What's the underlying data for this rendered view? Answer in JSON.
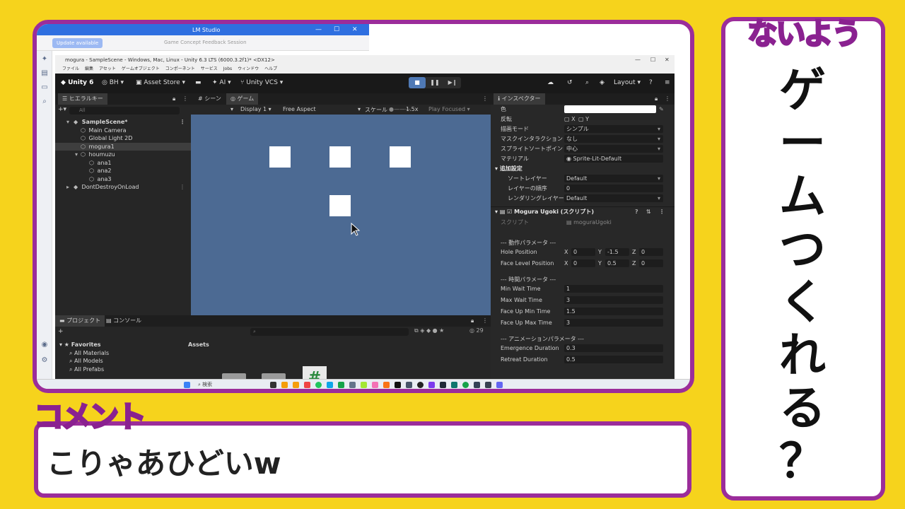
{
  "overlay": {
    "side_title": "ないよう",
    "side_vertical": [
      "ゲ",
      "ー",
      "ム",
      "つ",
      "く",
      "れ",
      "る",
      "？"
    ],
    "comment_title": "コメント",
    "comment_text": "こりゃあひどいw"
  },
  "lm_studio": {
    "title": "LM Studio",
    "update_button": "Update available",
    "session": "Game Concept Feedback Session"
  },
  "unity": {
    "window_title": "mogura - SampleScene - Windows, Mac, Linux - Unity 6.3 LTS (6000.3.2f1)* <DX12>",
    "menu": [
      "ファイル",
      "編集",
      "アセット",
      "ゲームオブジェクト",
      "コンポーネント",
      "サービス",
      "Jobs",
      "ウィンドウ",
      "ヘルプ"
    ],
    "toolbar": {
      "app": "Unity 6",
      "account": "BH",
      "asset_store": "Asset Store",
      "ai": "AI",
      "vcs": "Unity VCS",
      "layout": "Layout"
    },
    "hierarchy": {
      "tab": "ヒエラルキー",
      "search_placeholder": "All",
      "items": [
        {
          "label": "SampleScene*",
          "indent": 0
        },
        {
          "label": "Main Camera",
          "indent": 1
        },
        {
          "label": "Global Light 2D",
          "indent": 1
        },
        {
          "label": "mogura1",
          "indent": 1
        },
        {
          "label": "houmuzu",
          "indent": 1
        },
        {
          "label": "ana1",
          "indent": 2
        },
        {
          "label": "ana2",
          "indent": 2
        },
        {
          "label": "ana3",
          "indent": 2
        },
        {
          "label": "DontDestroyOnLoad",
          "indent": 0
        }
      ]
    },
    "game": {
      "tab_scene": "シーン",
      "tab_game": "ゲーム",
      "display": "Display 1",
      "aspect": "Free Aspect",
      "scale_label": "スケール",
      "scale_value": "1.5x",
      "play_focused": "Play Focused"
    },
    "inspector": {
      "tab": "インスペクター",
      "color_label": "色",
      "flip_label": "反転",
      "flip_x": "X",
      "flip_y": "Y",
      "draw_mode_label": "描画モード",
      "draw_mode_value": "シンプル",
      "mask_label": "マスクインタラクション",
      "mask_value": "なし",
      "sort_point_label": "スプライトソートポイント",
      "sort_point_value": "中心",
      "material_label": "マテリアル",
      "material_value": "Sprite-Lit-Default",
      "extra_section": "追加設定",
      "sorting_layer_label": "ソートレイヤー",
      "sorting_layer_value": "Default",
      "order_label": "レイヤーの順序",
      "order_value": "0",
      "render_layer_label": "レンダリングレイヤーマス",
      "render_layer_value": "Default",
      "component_title": "Mogura Ugoki (スクリプト)",
      "script_label": "スクリプト",
      "script_value": "moguraUgoki",
      "motion_section": "--- 動作パラメータ ---",
      "hole_label": "Hole Position",
      "hole": {
        "x": "0",
        "y": "-1.5",
        "z": "0"
      },
      "face_label": "Face Level Position",
      "face": {
        "x": "0",
        "y": "0.5",
        "z": "0"
      },
      "time_section": "--- 時間パラメータ ---",
      "min_wait_label": "Min Wait Time",
      "min_wait": "1",
      "max_wait_label": "Max Wait Time",
      "max_wait": "3",
      "face_up_min_label": "Face Up Min Time",
      "face_up_min": "1.5",
      "face_up_max_label": "Face Up Max Time",
      "face_up_max": "3",
      "anim_section": "--- アニメーションパラメータ ---",
      "emergence_label": "Emergence Duration",
      "emergence": "0.3",
      "retreat_label": "Retreat Duration",
      "retreat": "0.5"
    },
    "project": {
      "tab_project": "プロジェクト",
      "tab_console": "コンソール",
      "count": "29",
      "favorites": "Favorites",
      "fav_items": [
        "All Materials",
        "All Models",
        "All Prefabs"
      ],
      "assets": "Assets"
    },
    "taskbar": {
      "search": "検索"
    }
  }
}
